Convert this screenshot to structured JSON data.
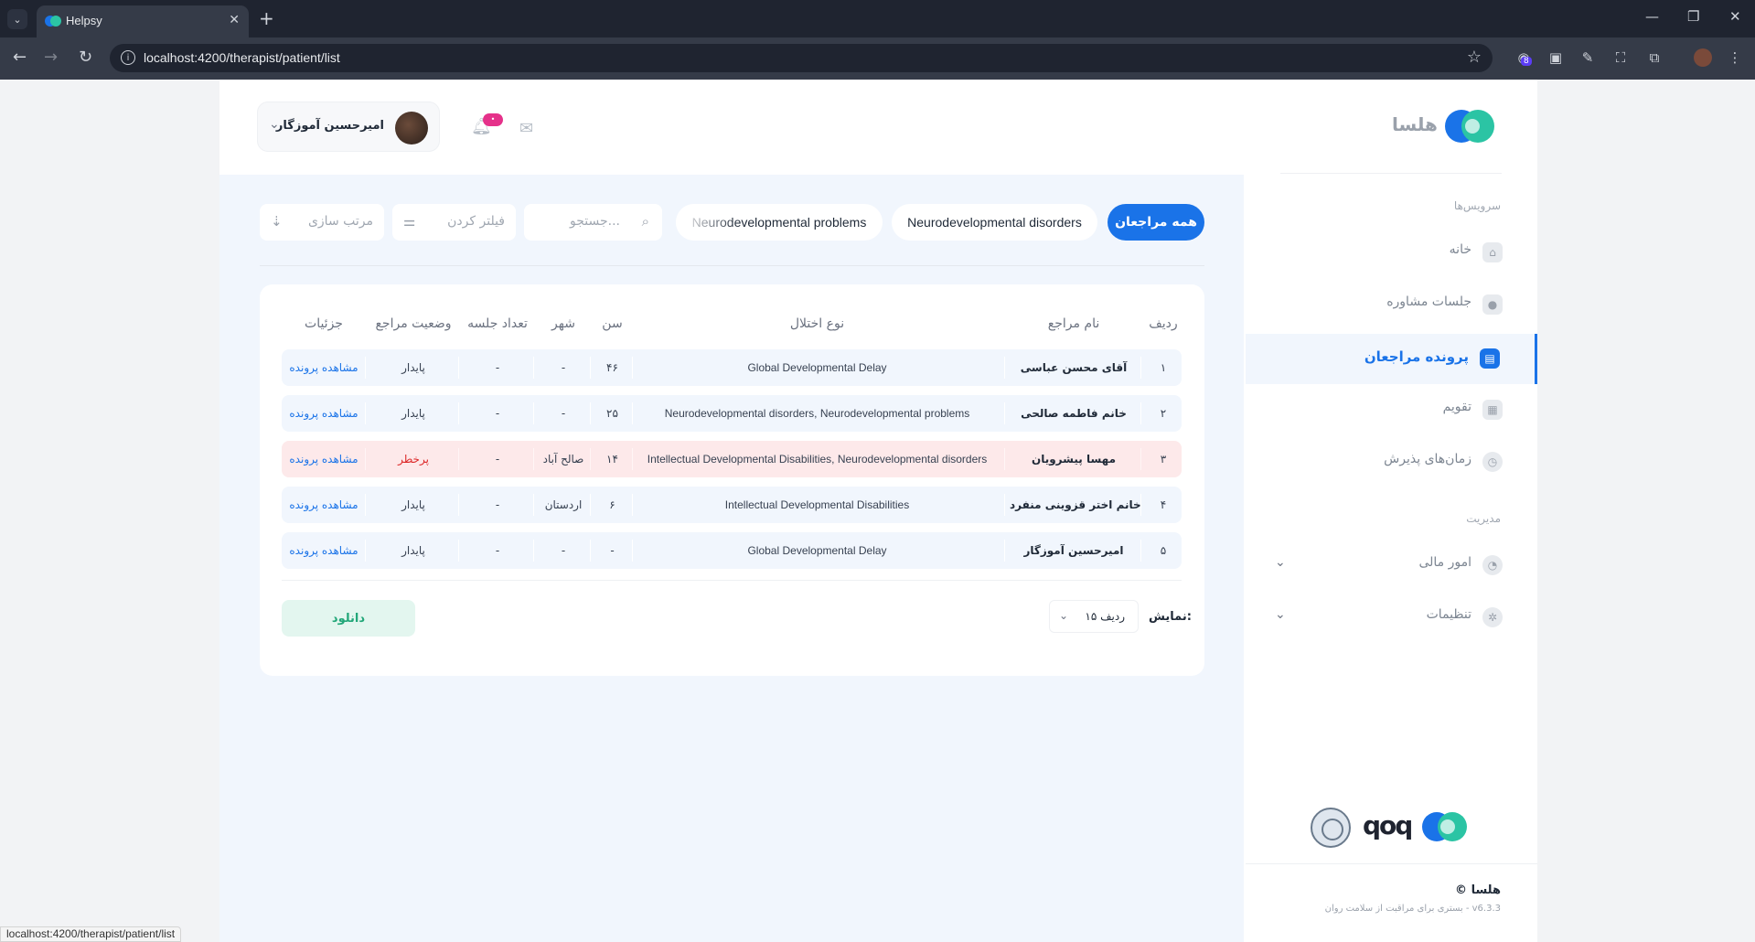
{
  "browser": {
    "tab_title": "Helpsy",
    "url": "localhost:4200/therapist/patient/list",
    "extension_badge": "8"
  },
  "brand": {
    "name": "هلسا",
    "colors": {
      "primary": "#1a73e8",
      "secondary": "#2bc4a4",
      "danger": "#dc2626",
      "success": "#22a779"
    }
  },
  "sidebar": {
    "section_services": "سرویس‌ها",
    "section_management": "مدیریت",
    "items": [
      {
        "label": "خانه",
        "icon": "home-icon"
      },
      {
        "label": "جلسات مشاوره",
        "icon": "user-icon"
      },
      {
        "label": "پرونده مراجعان",
        "icon": "document-icon",
        "active": true
      },
      {
        "label": "تقویم",
        "icon": "calendar-icon"
      },
      {
        "label": "زمان‌های پذیرش",
        "icon": "clock-icon"
      }
    ],
    "management_items": [
      {
        "label": "امور مالی",
        "icon": "pie-chart-icon"
      },
      {
        "label": "تنظیمات",
        "icon": "gear-icon"
      }
    ],
    "footer_brand": "© هلسا",
    "footer_tagline": "بستری برای مراقبت از سلامت روان - v6.3.3"
  },
  "header": {
    "user_name": "امیرحسین آموزگار",
    "notification_badge": "•"
  },
  "filters": {
    "chips": [
      "همه مراجعان",
      "Neurodevelopmental disorders",
      "Neurodevelopmental problems"
    ],
    "search_placeholder": "جستجو...",
    "filter_label": "فیلتر کردن",
    "sort_label": "مرتب سازی"
  },
  "table": {
    "headers": [
      "ردیف",
      "نام مراجع",
      "نوع اختلال",
      "سن",
      "شهر",
      "تعداد جلسه",
      "وضعیت مراجع",
      "جزئیات"
    ],
    "rows": [
      {
        "index": "۱",
        "name": "آقای محسن عباسی",
        "disorder": "Global Developmental Delay",
        "age": "۴۶",
        "city": "-",
        "sessions": "-",
        "status": "پایدار",
        "details": "مشاهده پرونده"
      },
      {
        "index": "۲",
        "name": "خانم فاطمه صالحی",
        "disorder": "Neurodevelopmental disorders, Neurodevelopmental problems",
        "age": "۲۵",
        "city": "-",
        "sessions": "-",
        "status": "پایدار",
        "details": "مشاهده پرونده"
      },
      {
        "index": "۳",
        "name": "مهسا پیشرویان",
        "disorder": "Intellectual Developmental Disabilities, Neurodevelopmental disorders",
        "age": "۱۴",
        "city": "صالح آباد",
        "sessions": "-",
        "status": "پرخطر",
        "details": "مشاهده پرونده"
      },
      {
        "index": "۴",
        "name": "خانم اختر قزوینی منفرد",
        "disorder": "Intellectual Developmental Disabilities",
        "age": "۶",
        "city": "اردستان",
        "sessions": "-",
        "status": "پایدار",
        "details": "مشاهده پرونده"
      },
      {
        "index": "۵",
        "name": "امیرحسین آموزگار",
        "disorder": "Global Developmental Delay",
        "age": "-",
        "city": "-",
        "sessions": "-",
        "status": "پایدار",
        "details": "مشاهده پرونده"
      }
    ]
  },
  "pagination": {
    "show_label": "نمایش:",
    "rows_value": "۱۵ ردیف",
    "download_label": "دانلود"
  },
  "status_bar_url": "localhost:4200/therapist/patient/list"
}
